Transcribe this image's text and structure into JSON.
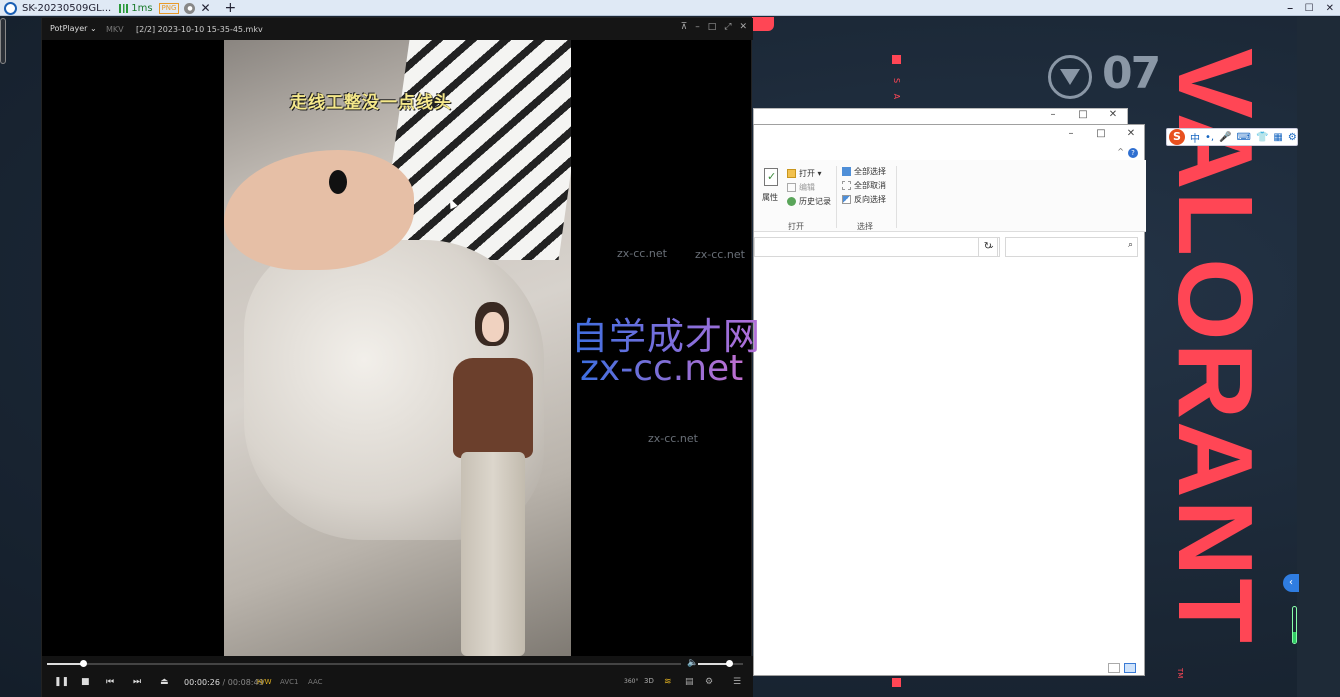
{
  "remote_bar": {
    "session": "SK-20230509GL...",
    "ping": "1ms",
    "chip": "PNG",
    "circle_icon": "gear-badge",
    "close": "✕",
    "add": "+",
    "win_min": "⎯",
    "win_max": "☐",
    "win_close": "✕"
  },
  "player": {
    "brand": "PotPlayer ⌄",
    "format": "MKV",
    "file": "[2/2] 2023-10-10 15-35-45.mkv",
    "title_controls": [
      "⊼",
      "–",
      "□",
      "⤢",
      "✕"
    ],
    "caption": "走线工整没一点线头",
    "progress": 0.056,
    "volume": 0.68,
    "time_current": "00:00:26",
    "time_sep": "/",
    "time_total": "00:08:49",
    "tag_hw": "H/W",
    "tag_video": "AVC1",
    "tag_audio": "AAC",
    "controls": {
      "pause": "❚❚",
      "stop": "■",
      "prev": "⏮",
      "next": "⏭",
      "eject": "⏏"
    },
    "right_controls": [
      "360°",
      "3D",
      "≋",
      "▤",
      "⚙",
      "☰"
    ]
  },
  "explorer": {
    "back_controls": [
      "–",
      "□",
      "✕"
    ],
    "main_controls": [
      "–",
      "□",
      "✕"
    ],
    "properties": "属性",
    "open": "打开 ▾",
    "edit": "编辑",
    "history": "历史记录",
    "group_open": "打开",
    "select_all": "全部选择",
    "select_none": "全部取消",
    "invert": "反向选择",
    "group_select": "选择",
    "refresh": "↻",
    "dropdown": "⌄",
    "search": "⌕",
    "help": "?",
    "chevron": "^"
  },
  "ime": {
    "logo": "S",
    "lang": "中",
    "items": [
      "•,",
      "🎤",
      "⌨",
      "👕",
      "▦",
      "⚙"
    ]
  },
  "watermark": {
    "title": "自学成才网",
    "domain": "zx-cc.net",
    "small": "zx-cc.net"
  },
  "desktop": {
    "badge_num": "07",
    "side": "S A",
    "brand": "VALORANT",
    "tm": "TM",
    "collapse": "‹"
  },
  "colors": {
    "accent_red": "#ff4655",
    "player_bg": "#000000",
    "hw_tag": "#e0b020"
  }
}
